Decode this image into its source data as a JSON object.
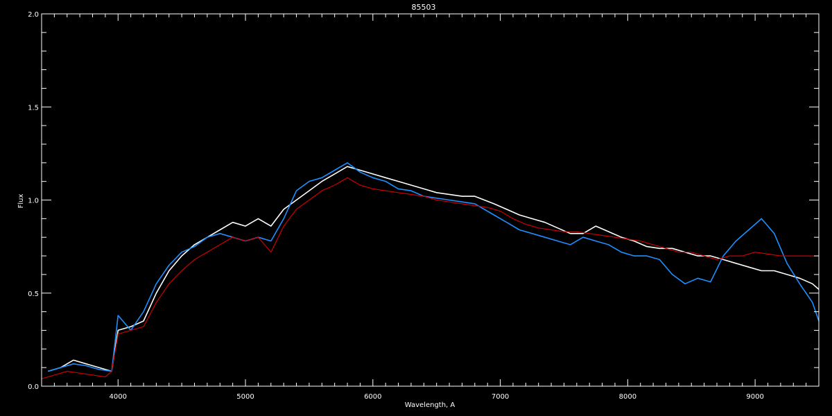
{
  "chart_data": {
    "type": "line",
    "title": "85503",
    "xlabel": "Wavelength, A",
    "ylabel": "Flux",
    "xlim": [
      3400,
      9500
    ],
    "ylim": [
      0.0,
      2.0
    ],
    "x_ticks": [
      4000,
      5000,
      6000,
      7000,
      8000,
      9000
    ],
    "x_tick_labels": [
      "4000",
      "5000",
      "6000",
      "7000",
      "8000",
      "9000"
    ],
    "y_ticks": [
      0.0,
      0.5,
      1.0,
      1.5,
      2.0
    ],
    "y_tick_labels": [
      "0.0",
      "0.5",
      "1.0",
      "1.5",
      "2.0"
    ],
    "grid": false,
    "background": "#000000",
    "series": [
      {
        "color": "#ffffff",
        "x": [
          3450,
          3550,
          3650,
          3750,
          3850,
          3950,
          4000,
          4100,
          4200,
          4300,
          4400,
          4500,
          4600,
          4700,
          4800,
          4900,
          5000,
          5100,
          5200,
          5300,
          5400,
          5500,
          5600,
          5700,
          5800,
          5900,
          6000,
          6100,
          6200,
          6300,
          6400,
          6500,
          6600,
          6700,
          6800,
          6950,
          7050,
          7150,
          7250,
          7350,
          7450,
          7550,
          7650,
          7750,
          7850,
          7950,
          8050,
          8150,
          8250,
          8350,
          8450,
          8550,
          8650,
          8750,
          8850,
          8950,
          9050,
          9150,
          9250,
          9350,
          9450,
          9500
        ],
        "y": [
          0.08,
          0.1,
          0.14,
          0.12,
          0.1,
          0.08,
          0.3,
          0.32,
          0.35,
          0.5,
          0.62,
          0.7,
          0.76,
          0.8,
          0.84,
          0.88,
          0.86,
          0.9,
          0.86,
          0.95,
          1.0,
          1.05,
          1.1,
          1.14,
          1.18,
          1.16,
          1.14,
          1.12,
          1.1,
          1.08,
          1.06,
          1.04,
          1.03,
          1.02,
          1.02,
          0.98,
          0.95,
          0.92,
          0.9,
          0.88,
          0.85,
          0.82,
          0.82,
          0.86,
          0.83,
          0.8,
          0.78,
          0.75,
          0.74,
          0.74,
          0.72,
          0.7,
          0.7,
          0.68,
          0.66,
          0.64,
          0.62,
          0.62,
          0.6,
          0.58,
          0.55,
          0.52
        ]
      },
      {
        "color": "#1e90ff",
        "x": [
          3450,
          3550,
          3650,
          3750,
          3850,
          3950,
          4000,
          4100,
          4200,
          4300,
          4400,
          4500,
          4600,
          4700,
          4800,
          4900,
          5000,
          5100,
          5200,
          5300,
          5400,
          5500,
          5600,
          5700,
          5800,
          5900,
          6000,
          6100,
          6200,
          6300,
          6400,
          6500,
          6600,
          6700,
          6800,
          6950,
          7050,
          7150,
          7250,
          7350,
          7450,
          7550,
          7650,
          7750,
          7850,
          7950,
          8050,
          8150,
          8250,
          8350,
          8450,
          8550,
          8650,
          8750,
          8850,
          8950,
          9050,
          9150,
          9250,
          9350,
          9450,
          9500
        ],
        "y": [
          0.08,
          0.1,
          0.12,
          0.11,
          0.09,
          0.08,
          0.38,
          0.3,
          0.4,
          0.55,
          0.65,
          0.72,
          0.75,
          0.8,
          0.82,
          0.8,
          0.78,
          0.8,
          0.78,
          0.9,
          1.05,
          1.1,
          1.12,
          1.16,
          1.2,
          1.15,
          1.12,
          1.1,
          1.06,
          1.05,
          1.02,
          1.01,
          1.0,
          0.99,
          0.98,
          0.92,
          0.88,
          0.84,
          0.82,
          0.8,
          0.78,
          0.76,
          0.8,
          0.78,
          0.76,
          0.72,
          0.7,
          0.7,
          0.68,
          0.6,
          0.55,
          0.58,
          0.56,
          0.7,
          0.78,
          0.84,
          0.9,
          0.82,
          0.66,
          0.55,
          0.45,
          0.35
        ]
      },
      {
        "color": "#cc0000",
        "x": [
          3400,
          3500,
          3600,
          3700,
          3800,
          3900,
          3950,
          4000,
          4100,
          4200,
          4300,
          4400,
          4500,
          4600,
          4700,
          4800,
          4900,
          5000,
          5100,
          5200,
          5300,
          5400,
          5500,
          5600,
          5700,
          5800,
          5900,
          6000,
          6100,
          6200,
          6300,
          6400,
          6500,
          6600,
          6700,
          6800,
          6900,
          7000,
          7100,
          7200,
          7300,
          7400,
          7500,
          7600,
          7700,
          7800,
          7900,
          8000,
          8100,
          8200,
          8300,
          8400,
          8500,
          8600,
          8700,
          8800,
          8900,
          9000,
          9100,
          9200,
          9300,
          9400,
          9500
        ],
        "y": [
          0.04,
          0.06,
          0.08,
          0.07,
          0.06,
          0.05,
          0.08,
          0.28,
          0.3,
          0.32,
          0.45,
          0.55,
          0.62,
          0.68,
          0.72,
          0.76,
          0.8,
          0.78,
          0.8,
          0.72,
          0.86,
          0.95,
          1.0,
          1.05,
          1.08,
          1.12,
          1.08,
          1.06,
          1.05,
          1.04,
          1.03,
          1.02,
          1.0,
          0.99,
          0.98,
          0.97,
          0.96,
          0.94,
          0.9,
          0.87,
          0.85,
          0.84,
          0.83,
          0.83,
          0.82,
          0.81,
          0.8,
          0.79,
          0.78,
          0.76,
          0.74,
          0.72,
          0.72,
          0.7,
          0.68,
          0.7,
          0.7,
          0.72,
          0.71,
          0.7,
          0.7,
          0.7,
          0.7
        ]
      }
    ]
  }
}
